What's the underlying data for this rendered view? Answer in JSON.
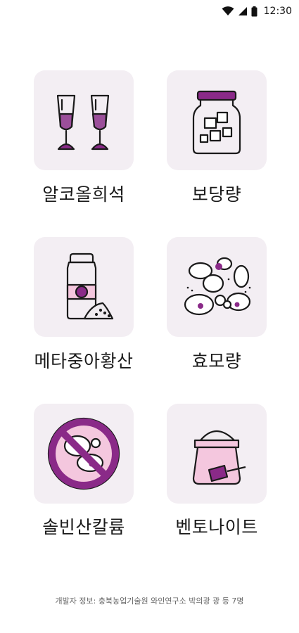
{
  "status_bar": {
    "time": "12:30",
    "icons": [
      "wifi-icon",
      "signal-icon",
      "battery-icon"
    ]
  },
  "menu": {
    "items": [
      {
        "label": "알코올희석",
        "icon": "wine-glasses-icon"
      },
      {
        "label": "보당량",
        "icon": "sugar-jar-icon"
      },
      {
        "label": "메타중아황산",
        "icon": "metabisulfite-bottle-icon"
      },
      {
        "label": "효모량",
        "icon": "yeast-icon"
      },
      {
        "label": "솔빈산칼륨",
        "icon": "no-yeast-icon"
      },
      {
        "label": "벤토나이트",
        "icon": "bentonite-sack-icon"
      }
    ]
  },
  "footer": {
    "text": "개발자 정보: 충북농업기술원 와인연구소 박의광 광 등 7명"
  },
  "colors": {
    "tile_background": "#f3eef3",
    "accent": "#8a2a88",
    "accent_light": "#f4c7de",
    "outline": "#1a1a1a"
  }
}
